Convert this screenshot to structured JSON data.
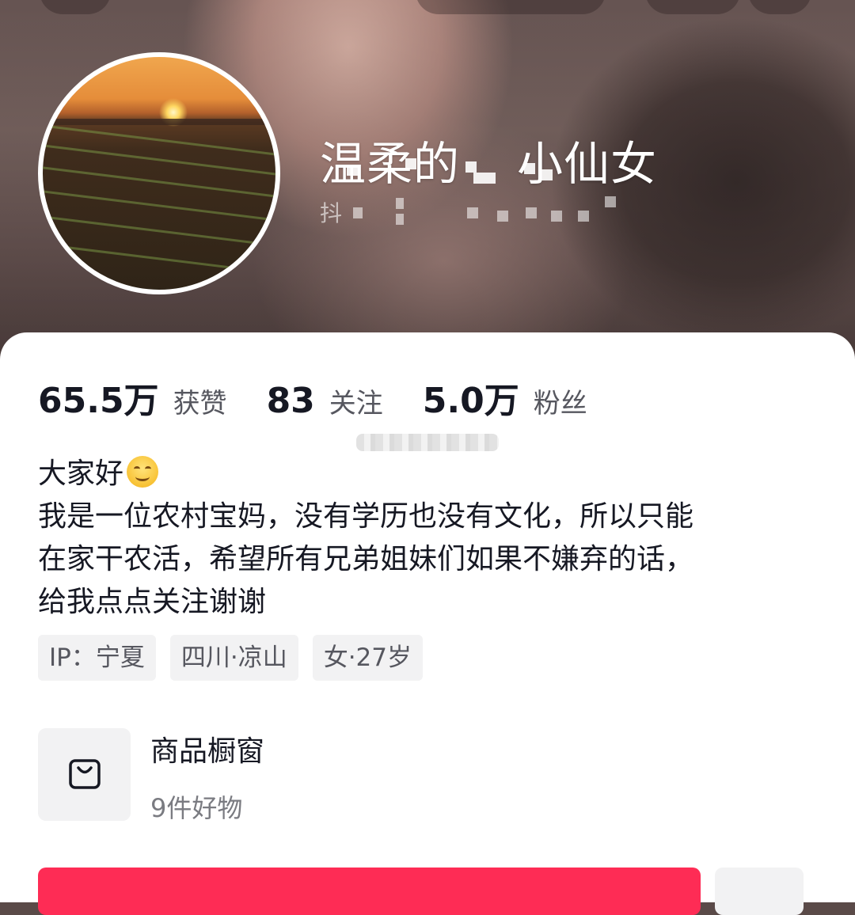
{
  "profile": {
    "username_visible_prefix": "温柔的",
    "username_visible_suffix": "小仙女",
    "uid_prefix": "抖"
  },
  "stats": [
    {
      "value": "65.5万",
      "label": "获赞"
    },
    {
      "value": "83",
      "label": "关注"
    },
    {
      "value": "5.0万",
      "label": "粉丝"
    }
  ],
  "bio": {
    "line1": "大家好",
    "line1_emoji": "smiling-face-icon",
    "line2": "我是一位农村宝妈，没有学历也没有文化，所以只能",
    "line3": "在家干农活，希望所有兄弟姐妹们如果不嫌弃的话，",
    "line4": "给我点点关注谢谢"
  },
  "tags": [
    "IP：宁夏",
    "四川·凉山",
    "女·27岁"
  ],
  "shop": {
    "title": "商品橱窗",
    "subtitle": "9件好物",
    "icon": "shopping-bag-icon"
  },
  "colors": {
    "accent": "#fe2c55",
    "text_primary": "#161823",
    "text_secondary": "#56575f",
    "tag_bg": "#f2f2f3"
  }
}
